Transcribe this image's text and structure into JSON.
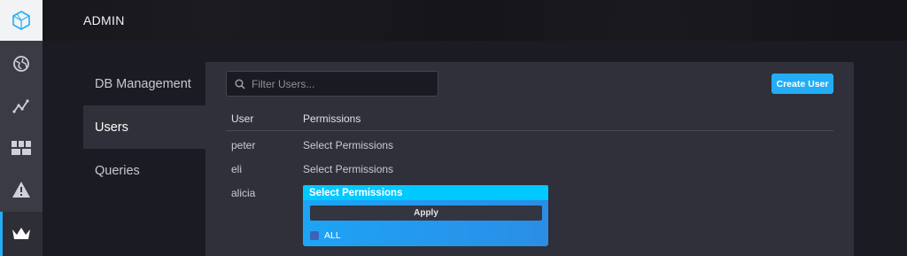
{
  "header": {
    "title": "ADMIN"
  },
  "rail": {
    "items": [
      {
        "icon": "logo-icon"
      },
      {
        "icon": "globe-icon"
      },
      {
        "icon": "graph-icon"
      },
      {
        "icon": "dashboard-grid-icon"
      },
      {
        "icon": "alert-icon"
      },
      {
        "icon": "crown-icon",
        "active": true
      }
    ]
  },
  "tabs": [
    {
      "label": "DB Management"
    },
    {
      "label": "Users",
      "active": true
    },
    {
      "label": "Queries"
    }
  ],
  "search": {
    "placeholder": "Filter Users...",
    "value": ""
  },
  "create_button": "Create User",
  "table": {
    "headers": [
      "User",
      "Permissions"
    ],
    "rows": [
      {
        "user": "peter",
        "permissions": "Select Permissions"
      },
      {
        "user": "eli",
        "permissions": "Select Permissions"
      },
      {
        "user": "alicia",
        "permissions": "Select Permissions"
      }
    ]
  },
  "dropdown": {
    "apply_label": "Apply",
    "options": [
      {
        "label": "ALL",
        "checked": false
      }
    ]
  },
  "colors": {
    "accent": "#22adf6",
    "dropdown_head": "#00c9ff"
  }
}
